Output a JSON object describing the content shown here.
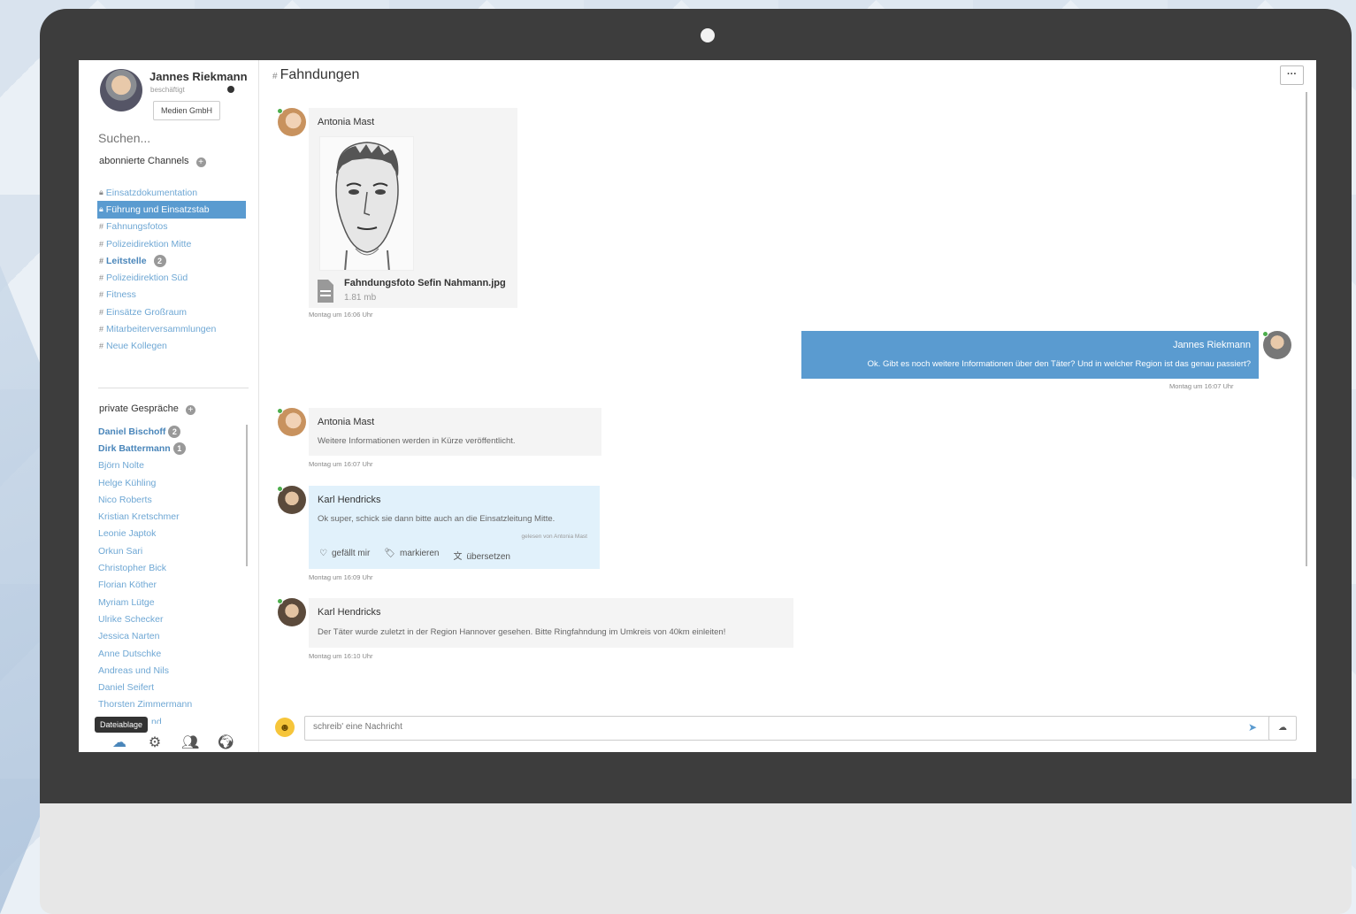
{
  "profile": {
    "name": "Jannes Riekmann",
    "status": "beschäftigt",
    "company": "Medien GmbH"
  },
  "search": {
    "placeholder": "Suchen..."
  },
  "channels": {
    "title": "abonnierte Channels",
    "items": [
      {
        "prefix": "lock",
        "label": "Einsatzdokumentation",
        "active": false,
        "bold": false,
        "badge": ""
      },
      {
        "prefix": "lock",
        "label": "Führung und Einsatzstab",
        "active": true,
        "bold": false,
        "badge": ""
      },
      {
        "prefix": "#",
        "label": "Fahnungsfotos",
        "active": false,
        "bold": false,
        "badge": ""
      },
      {
        "prefix": "#",
        "label": "Polizeidirektion Mitte",
        "active": false,
        "bold": false,
        "badge": ""
      },
      {
        "prefix": "#",
        "label": "Leitstelle",
        "active": false,
        "bold": true,
        "badge": "2"
      },
      {
        "prefix": "#",
        "label": "Polizeidirektion Süd",
        "active": false,
        "bold": false,
        "badge": ""
      },
      {
        "prefix": "#",
        "label": "Fitness",
        "active": false,
        "bold": false,
        "badge": ""
      },
      {
        "prefix": "#",
        "label": "Einsätze Großraum",
        "active": false,
        "bold": false,
        "badge": ""
      },
      {
        "prefix": "#",
        "label": "Mitarbeiterversammlungen",
        "active": false,
        "bold": false,
        "badge": ""
      },
      {
        "prefix": "#",
        "label": "Neue Kollegen",
        "active": false,
        "bold": false,
        "badge": ""
      }
    ]
  },
  "private": {
    "title": "private Gespräche",
    "contacts": [
      {
        "name": "Daniel Bischoff",
        "bold": true,
        "badge": "2"
      },
      {
        "name": "Dirk Battermann",
        "bold": true,
        "badge": "1"
      },
      {
        "name": "Björn Nolte",
        "bold": false,
        "badge": ""
      },
      {
        "name": "Helge Kühling",
        "bold": false,
        "badge": ""
      },
      {
        "name": "Nico Roberts",
        "bold": false,
        "badge": ""
      },
      {
        "name": "Kristian Kretschmer",
        "bold": false,
        "badge": ""
      },
      {
        "name": "Leonie Japtok",
        "bold": false,
        "badge": ""
      },
      {
        "name": "Orkun Sari",
        "bold": false,
        "badge": ""
      },
      {
        "name": "Christopher Bick",
        "bold": false,
        "badge": ""
      },
      {
        "name": "Florian Köther",
        "bold": false,
        "badge": ""
      },
      {
        "name": "Myriam Lütge",
        "bold": false,
        "badge": ""
      },
      {
        "name": "Ulrike Schecker",
        "bold": false,
        "badge": ""
      },
      {
        "name": "Jessica Narten",
        "bold": false,
        "badge": ""
      },
      {
        "name": "Anne Dutschke",
        "bold": false,
        "badge": ""
      },
      {
        "name": "Andreas und Nils",
        "bold": false,
        "badge": ""
      },
      {
        "name": "Daniel Seifert",
        "bold": false,
        "badge": ""
      },
      {
        "name": "Thorsten Zimmermann",
        "bold": false,
        "badge": ""
      },
      {
        "name": "nd",
        "bold": false,
        "badge": ""
      }
    ]
  },
  "bottom_bar": {
    "tooltip": "Dateiablage",
    "icons": [
      "cloud-icon",
      "gears-icon",
      "users-icon",
      "globe-icon"
    ]
  },
  "main": {
    "channel_title": "Fahndungen",
    "hash": "#",
    "more": "···"
  },
  "messages": {
    "m1": {
      "author": "Antonia Mast",
      "file_name": "Fahndungsfoto Sefin Nahmann.jpg",
      "file_size": "1.81 mb",
      "time": "Montag um 16:06 Uhr"
    },
    "m2": {
      "author": "Jannes Riekmann",
      "text": "Ok. Gibt es noch weitere Informationen über den Täter? Und in welcher Region ist das genau passiert?",
      "time": "Montag um 16:07 Uhr"
    },
    "m3": {
      "author": "Antonia Mast",
      "text": "Weitere Informationen werden in Kürze veröffentlicht.",
      "time": "Montag um 16:07 Uhr"
    },
    "m4": {
      "author": "Karl Hendricks",
      "text": "Ok super, schick sie dann bitte auch an die Einsatzleitung Mitte.",
      "read_by": "gelesen von Antonia Mast",
      "like": "gefällt mir",
      "tag": "markieren",
      "translate": "übersetzen",
      "time": "Montag um 16:09 Uhr"
    },
    "m5": {
      "author": "Karl Hendricks",
      "text": "Der Täter wurde zuletzt in der Region Hannover gesehen. Bitte Ringfahndung im Umkreis von 40km einleiten!",
      "time": "Montag um 16:10 Uhr"
    }
  },
  "composer": {
    "placeholder": "schreib' eine Nachricht"
  },
  "colors": {
    "accent": "#5a9bd0",
    "link": "#6ea7d4",
    "online": "#4cae4c",
    "frame": "#3d3d3d"
  }
}
